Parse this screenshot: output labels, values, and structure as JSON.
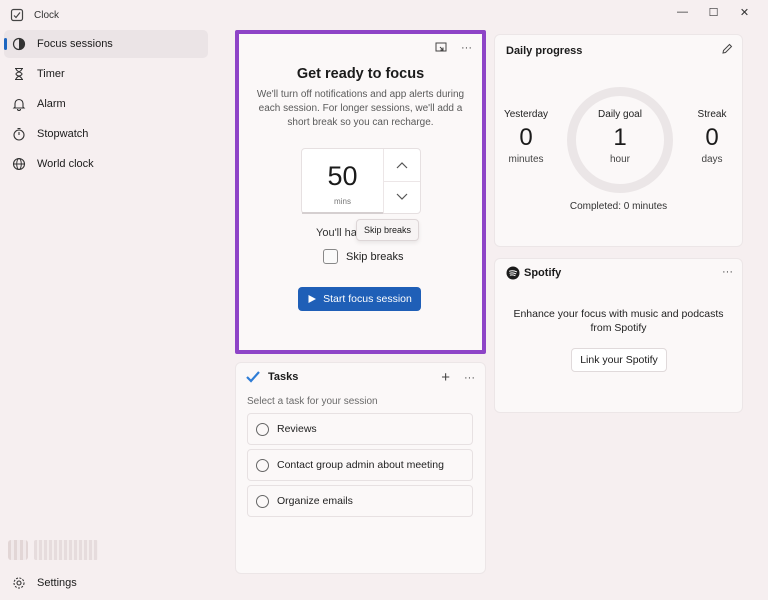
{
  "app": {
    "title": "Clock"
  },
  "window_controls": {
    "minimize": "—",
    "maximize": "☐",
    "close": "✕"
  },
  "sidebar": {
    "items": [
      {
        "label": "Focus sessions",
        "icon": "focus-icon",
        "active": true
      },
      {
        "label": "Timer",
        "icon": "hourglass-icon",
        "active": false
      },
      {
        "label": "Alarm",
        "icon": "bell-icon",
        "active": false
      },
      {
        "label": "Stopwatch",
        "icon": "stopwatch-icon",
        "active": false
      },
      {
        "label": "World clock",
        "icon": "globe-icon",
        "active": false
      }
    ],
    "settings_label": "Settings"
  },
  "focus": {
    "title": "Get ready to focus",
    "description": "We'll turn off notifications and app alerts during each session. For longer sessions, we'll add a short break so you can recharge.",
    "minutes_value": "50",
    "minutes_unit": "mins",
    "youll_have_text": "You'll ha",
    "tooltip": "Skip breaks",
    "skip_breaks_label": "Skip breaks",
    "skip_breaks_checked": false,
    "start_label": "Start focus session"
  },
  "tasks": {
    "title": "Tasks",
    "add_icon": "+",
    "more_icon": "···",
    "subtitle": "Select a task for your session",
    "items": [
      "Reviews",
      "Contact group admin about meeting",
      "Organize emails"
    ]
  },
  "progress": {
    "title": "Daily progress",
    "yesterday": {
      "label": "Yesterday",
      "value": "0",
      "unit": "minutes"
    },
    "goal": {
      "label": "Daily goal",
      "value": "1",
      "unit": "hour"
    },
    "streak": {
      "label": "Streak",
      "value": "0",
      "unit": "days"
    },
    "completed": "Completed: 0 minutes"
  },
  "spotify": {
    "brand": "Spotify",
    "description": "Enhance your focus with music and podcasts from Spotify",
    "link_label": "Link your Spotify"
  },
  "colors": {
    "accent": "#1f5fb7",
    "highlight_border": "#8e44c7",
    "background": "#f6eff0"
  }
}
